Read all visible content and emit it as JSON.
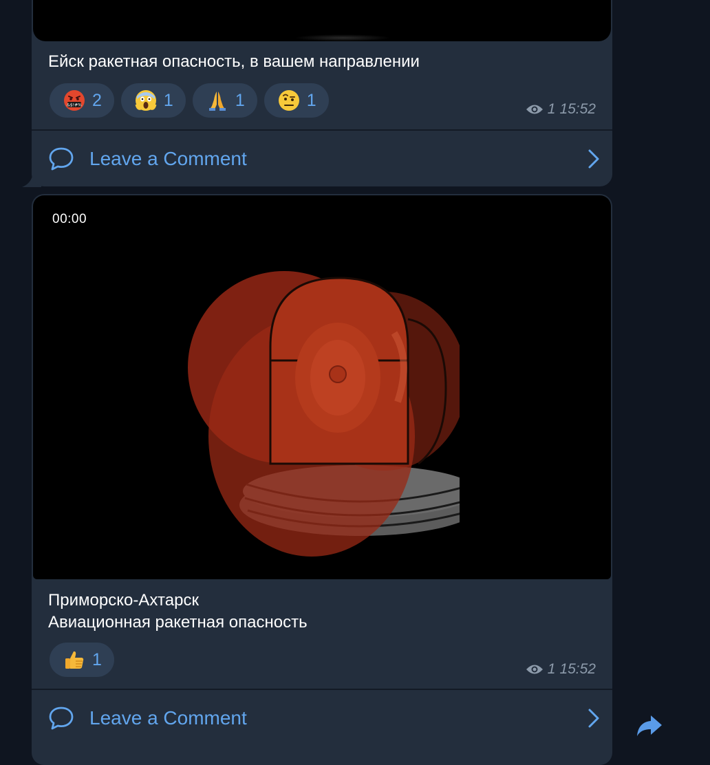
{
  "posts": [
    {
      "caption": "Ейск ракетная опасность, в вашем направлении",
      "reactions": [
        {
          "icon": "angry-swearing-face-emoji",
          "count": "2"
        },
        {
          "icon": "screaming-face-emoji",
          "count": "1"
        },
        {
          "icon": "folded-hands-emoji",
          "count": "1"
        },
        {
          "icon": "raised-eyebrow-face-emoji",
          "count": "1"
        }
      ],
      "views": "1",
      "time": "15:52",
      "comment_label": "Leave a Comment"
    },
    {
      "video_time": "00:00",
      "caption_line1": "Приморско-Ахтарск",
      "caption_line2": "Авиационная ракетная опасность",
      "reactions": [
        {
          "icon": "thumbs-up-emoji",
          "count": "1"
        }
      ],
      "views": "1",
      "time": "15:52",
      "comment_label": "Leave a Comment"
    }
  ],
  "colors": {
    "background": "#0f1520",
    "bubble": "#232e3d",
    "reaction_pill": "#2f3f54",
    "accent": "#62a6ee",
    "meta_text": "#8d9bab"
  },
  "icons": [
    "eye-icon",
    "comment-bubble-icon",
    "chevron-right-icon",
    "share-arrow-icon",
    "siren-image"
  ]
}
